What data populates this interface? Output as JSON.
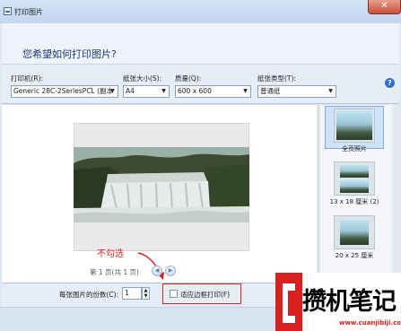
{
  "window": {
    "title": "打印图片",
    "close_label": "✕"
  },
  "header": {
    "question": "您希望如何打印图片?"
  },
  "options": {
    "printer": {
      "label": "打印机(R):",
      "value": "Generic 28C-2SeriesPCL (副本"
    },
    "paper_size": {
      "label": "纸张大小(S):",
      "value": "A4"
    },
    "quality": {
      "label": "质量(Q):",
      "value": "600 x 600"
    },
    "paper_type": {
      "label": "纸张类型(T):",
      "value": "普通纸"
    },
    "help_label": "?"
  },
  "preview": {
    "annotation": "不勾选",
    "page_info": "第 1 页(共 1 页)",
    "prev_icon": "◀",
    "next_icon": "▶"
  },
  "layouts": [
    {
      "label": "全页照片",
      "selected": true
    },
    {
      "label": "13 x 18 厘米 (2)",
      "selected": false
    },
    {
      "label": "20 x 25 厘米",
      "selected": false
    }
  ],
  "footer": {
    "copies_label": "每张图片的份数(C):",
    "copies_value": "1",
    "fit_label": "适应边框打印(F)",
    "fit_checked": false
  },
  "watermark": {
    "text": "攒机笔记",
    "url": "www.cuanjibiji.com"
  },
  "colors": {
    "annotation": "#d82323",
    "highlight_box": "#e02424",
    "heading": "#1d3a78"
  }
}
